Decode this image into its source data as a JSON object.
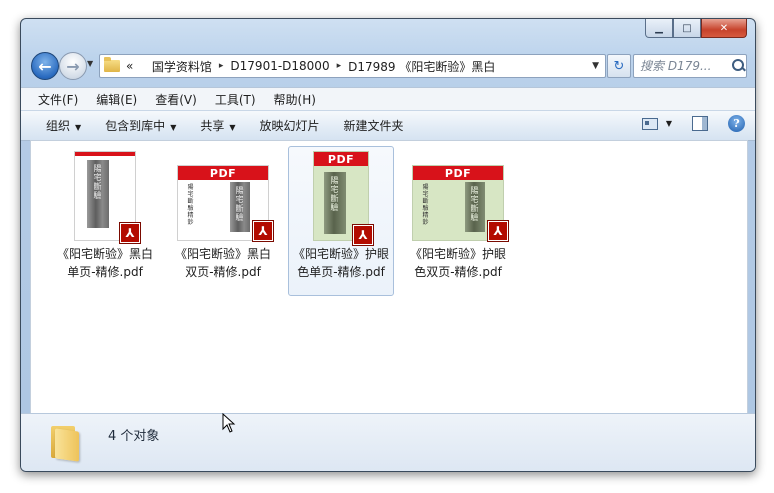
{
  "window": {
    "caption_buttons": {
      "minimize": "▁",
      "maximize": "□",
      "close": "✕"
    }
  },
  "nav": {
    "breadcrumb_prefix": "«",
    "breadcrumbs": [
      "国学资料馆",
      "D17901-D18000",
      "D17989 《阳宅断验》黑白"
    ],
    "separator": "▸",
    "search_placeholder": "搜索 D179..."
  },
  "menu": [
    "文件(F)",
    "编辑(E)",
    "查看(V)",
    "工具(T)",
    "帮助(H)"
  ],
  "toolbar": {
    "organize": "组织",
    "include_library": "包含到库中",
    "share": "共享",
    "slideshow": "放映幻灯片",
    "new_folder": "新建文件夹"
  },
  "files": [
    {
      "name": "《阳宅断验》黑白单页-精修.pdf",
      "style": "bw-single",
      "selected": false
    },
    {
      "name": "《阳宅断验》黑白双页-精修.pdf",
      "style": "bw-double",
      "selected": false
    },
    {
      "name": "《阳宅断验》护眼色单页-精修.pdf",
      "style": "green-single",
      "selected": true
    },
    {
      "name": "《阳宅断验》护眼色双页-精修.pdf",
      "style": "green-double",
      "selected": false
    }
  ],
  "thumb_text": {
    "pdf": "PDF",
    "scan_title": "陽宅斷驗",
    "cover_line": "陽宅斷驗精鈔",
    "acrobat": "⅄"
  },
  "status": {
    "item_count": "4 个对象"
  },
  "colors": {
    "accent": "#2a6bc0",
    "pdf_red": "#d8121a",
    "eye_care_green": "#d7e6c4"
  }
}
